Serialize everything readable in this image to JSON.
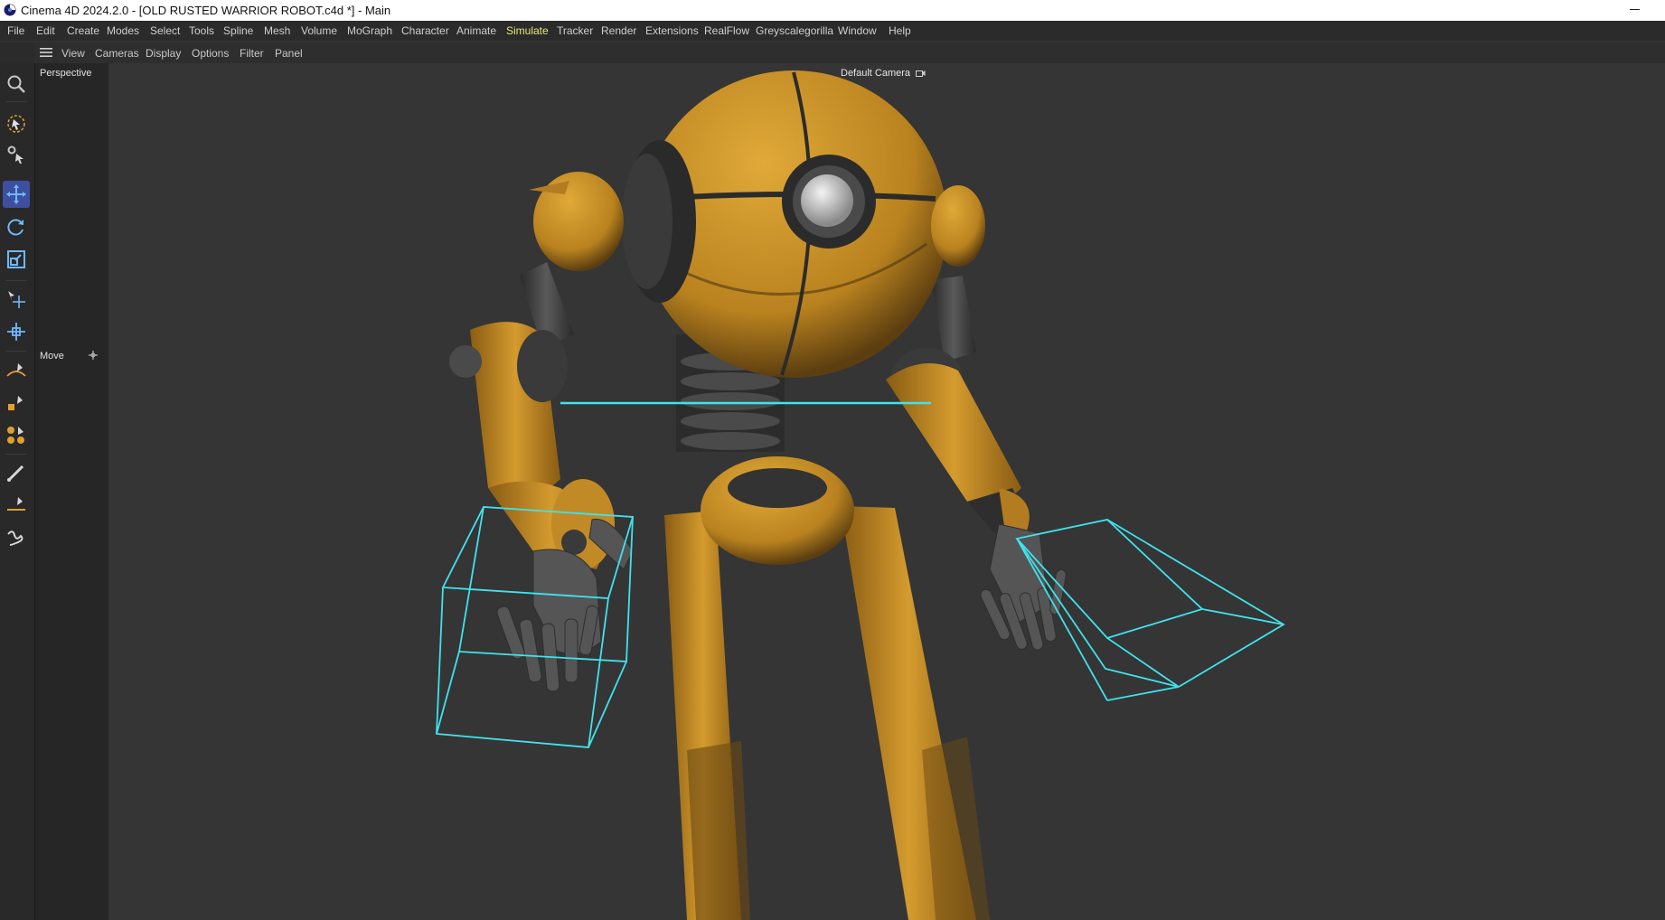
{
  "window": {
    "title": "Cinema 4D 2024.2.0 - [OLD RUSTED WARRIOR ROBOT.c4d *] - Main",
    "app_icon": "cinema4d-logo-icon"
  },
  "menu": {
    "items": [
      "File",
      "Edit",
      "Create",
      "Modes",
      "Select",
      "Tools",
      "Spline",
      "Mesh",
      "Volume",
      "MoGraph",
      "Character",
      "Animate",
      "Simulate",
      "Tracker",
      "Render",
      "Extensions",
      "RealFlow",
      "Greyscalegorilla",
      "Window",
      "Help"
    ],
    "active": "Simulate"
  },
  "viewport_menu": {
    "items": [
      "View",
      "Cameras",
      "Display",
      "Options",
      "Filter",
      "Panel"
    ]
  },
  "tools": [
    {
      "name": "search-icon",
      "active": false
    },
    {
      "name": "live-selection-icon",
      "active": false
    },
    {
      "name": "tweak-icon",
      "active": false
    },
    {
      "name": "move-icon",
      "active": true
    },
    {
      "name": "rotate-icon",
      "active": false
    },
    {
      "name": "scale-icon",
      "active": false
    },
    {
      "name": "move-object-icon",
      "active": false
    },
    {
      "name": "transform-icon",
      "active": false
    },
    {
      "name": "spline-pen-icon",
      "active": false
    },
    {
      "name": "primitive-pen-icon",
      "active": false
    },
    {
      "name": "mograph-cloner-icon",
      "active": false
    },
    {
      "name": "paint-brush-icon",
      "active": false
    },
    {
      "name": "line-pen-icon",
      "active": false
    },
    {
      "name": "sketch-icon",
      "active": false
    }
  ],
  "panel": {
    "view_name": "Perspective",
    "tool_name": "Move"
  },
  "viewport": {
    "camera_label": "Default Camera",
    "scene": "rusted yellow warrior robot model with cyan bounding boxes around both hands"
  },
  "colors": {
    "accent": "#3f4fa0",
    "active_menu": "#e8e67a",
    "selection_cyan": "#3fe3ee",
    "robot_yellow": "#d19a2a"
  }
}
